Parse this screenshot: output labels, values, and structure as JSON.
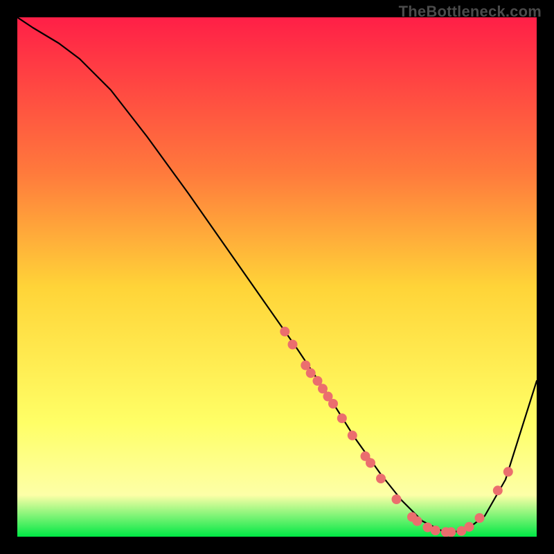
{
  "watermark": "TheBottleneck.com",
  "colors": {
    "gradient_top": "#ff1f47",
    "gradient_mid_upper": "#ff7a3c",
    "gradient_mid": "#ffd438",
    "gradient_mid_lower": "#ffff66",
    "gradient_lower": "#fdffa7",
    "gradient_bottom": "#00e845",
    "curve": "#000000",
    "marker": "#eb6e6e"
  },
  "chart_data": {
    "type": "line",
    "title": "",
    "xlabel": "",
    "ylabel": "",
    "xlim": [
      0,
      100
    ],
    "ylim": [
      0,
      100
    ],
    "curve": {
      "x": [
        0,
        3,
        8,
        12,
        18,
        25,
        33,
        40,
        47,
        54,
        60,
        65,
        70,
        74,
        78,
        82,
        86,
        90,
        94,
        100
      ],
      "y": [
        100,
        98,
        95,
        92,
        86,
        77,
        66,
        56,
        46,
        36,
        27,
        19,
        12,
        7,
        3,
        1,
        1,
        4,
        11,
        30
      ]
    },
    "markers": [
      {
        "x": 51.5,
        "y": 39.5
      },
      {
        "x": 53.0,
        "y": 37.0
      },
      {
        "x": 55.5,
        "y": 33.0
      },
      {
        "x": 56.5,
        "y": 31.5
      },
      {
        "x": 57.8,
        "y": 30.0
      },
      {
        "x": 58.8,
        "y": 28.5
      },
      {
        "x": 59.8,
        "y": 27.0
      },
      {
        "x": 60.8,
        "y": 25.6
      },
      {
        "x": 62.5,
        "y": 22.8
      },
      {
        "x": 64.5,
        "y": 19.5
      },
      {
        "x": 67.0,
        "y": 15.5
      },
      {
        "x": 68.0,
        "y": 14.2
      },
      {
        "x": 70.0,
        "y": 11.2
      },
      {
        "x": 73.0,
        "y": 7.2
      },
      {
        "x": 76.0,
        "y": 3.8
      },
      {
        "x": 77.0,
        "y": 3.0
      },
      {
        "x": 79.0,
        "y": 1.8
      },
      {
        "x": 80.5,
        "y": 1.2
      },
      {
        "x": 82.5,
        "y": 0.9
      },
      {
        "x": 83.5,
        "y": 0.9
      },
      {
        "x": 85.5,
        "y": 1.1
      },
      {
        "x": 87.0,
        "y": 1.9
      },
      {
        "x": 89.0,
        "y": 3.6
      },
      {
        "x": 92.5,
        "y": 8.9
      },
      {
        "x": 94.5,
        "y": 12.5
      }
    ]
  }
}
